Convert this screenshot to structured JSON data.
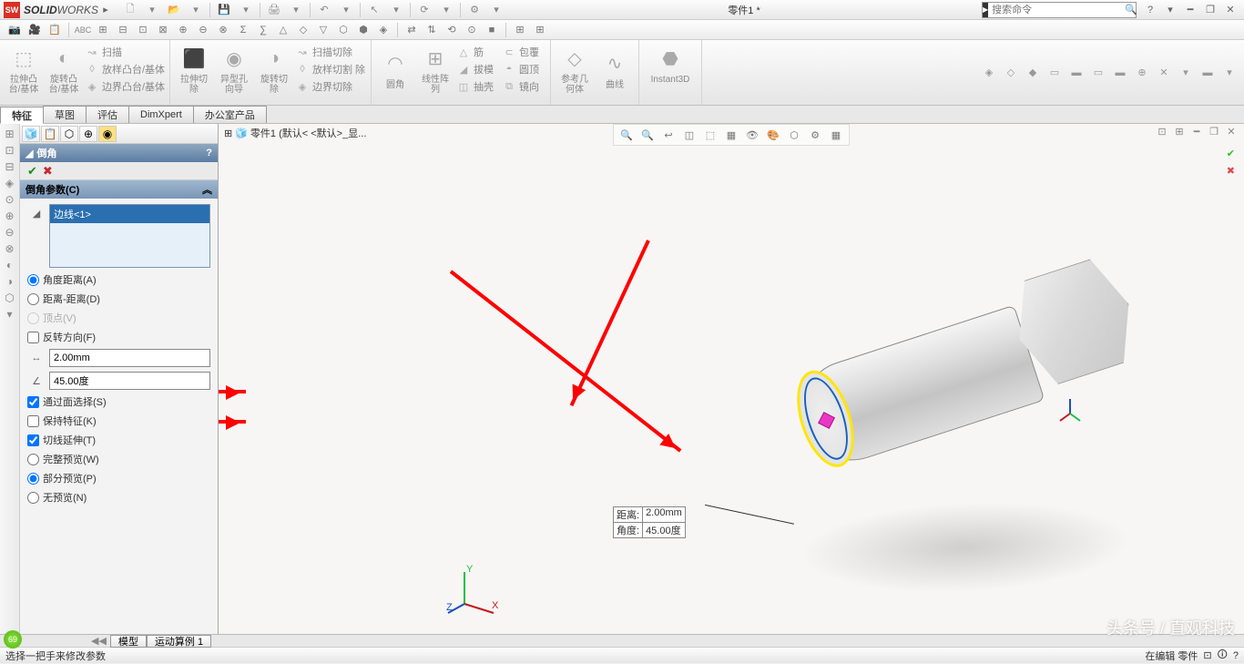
{
  "title_bar": {
    "brand1": "SOLID",
    "brand2": "WORKS",
    "doc_title": "零件1 *",
    "search_placeholder": "搜索命令",
    "help": "?"
  },
  "ribbon": {
    "extrude_boss": "拉伸凸\n台/基体",
    "revolve_boss": "旋转凸\n台/基体",
    "sweep": "扫描",
    "loft": "放样凸台/基体",
    "boundary": "边界凸台/基体",
    "extrude_cut": "拉伸切\n除",
    "hole_wizard": "异型孔\n向导",
    "revolve_cut": "旋转切\n除",
    "sweep_cut": "扫描切除",
    "loft_cut": "放样切割\n除",
    "boundary_cut": "边界切除",
    "fillet": "圆角",
    "linear_pattern": "线性阵\n列",
    "rib": "筋",
    "draft": "拔模",
    "shell": "抽壳",
    "wrap": "包覆",
    "dome": "圆顶",
    "mirror": "镜向",
    "ref_geom": "参考几\n何体",
    "curves": "曲线",
    "instant3d": "Instant3D"
  },
  "tabs": {
    "feature": "特征",
    "sketch": "草图",
    "evaluate": "评估",
    "dimxpert": "DimXpert",
    "office": "办公室产品"
  },
  "tree_top": "零件1  (默认< <默认>_显...",
  "fm": {
    "title": "倒角",
    "section": "倒角参数(C)",
    "edge_item": "边线<1>",
    "opt_angle_dist": "角度距离(A)",
    "opt_dist_dist": "距离-距离(D)",
    "opt_vertex": "顶点(V)",
    "flip": "反转方向(F)",
    "dist_value": "2.00mm",
    "ang_value": "45.00度",
    "face_sel": "通过面选择(S)",
    "keep_feat": "保持特征(K)",
    "tangent": "切线延伸(T)",
    "full_preview": "完整预览(W)",
    "part_preview": "部分预览(P)",
    "no_preview": "无预览(N)"
  },
  "dim_labels": {
    "dist_lbl": "距离:",
    "dist_val": "2.00mm",
    "ang_lbl": "角度:",
    "ang_val": "45.00度"
  },
  "bottom_tabs": {
    "model": "模型",
    "motion": "运动算例 1",
    "badge": "69"
  },
  "status": {
    "left": "选择一把手来修改参数",
    "right": "在编辑 零件"
  },
  "watermark": "头条号 / 直观科技"
}
